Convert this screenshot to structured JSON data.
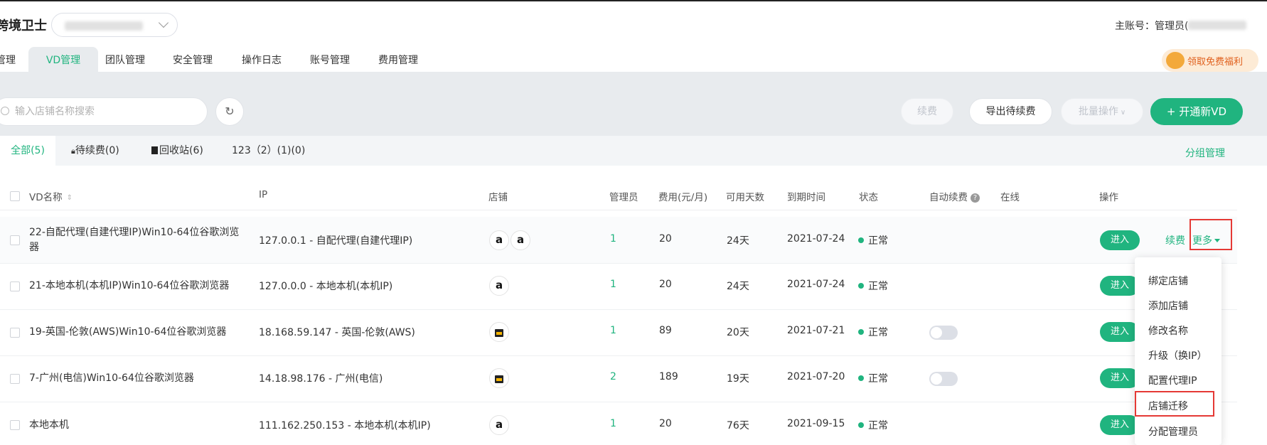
{
  "app": {
    "brand": "跨境卫士",
    "main_account_label": "主账号：管理员("
  },
  "nav": {
    "tabs": [
      {
        "label": "管理",
        "active": false
      },
      {
        "label": "VD管理",
        "active": true
      },
      {
        "label": "团队管理",
        "active": false
      },
      {
        "label": "安全管理",
        "active": false
      },
      {
        "label": "操作日志",
        "active": false
      },
      {
        "label": "账号管理",
        "active": false
      },
      {
        "label": "费用管理",
        "active": false
      }
    ]
  },
  "promo": {
    "label": "领取免费福利"
  },
  "toolbar": {
    "search_placeholder": "输入店铺名称搜索",
    "renew": "续费",
    "export": "导出待续费",
    "batch": "批量操作",
    "new_vd": "+ 开通新VD"
  },
  "subtabs": [
    {
      "label": "全部(5)",
      "active": true
    },
    {
      "label": "待续费(0)",
      "active": false
    },
    {
      "label": "回收站(6)",
      "active": false
    },
    {
      "label": "123（2）(1)(0)",
      "active": false
    }
  ],
  "group_management": "分组管理",
  "table": {
    "headers": {
      "name": "VD名称",
      "ip": "IP",
      "shop": "店铺",
      "admin": "管理员",
      "fee": "费用(元/月)",
      "days": "可用天数",
      "expire": "到期时间",
      "status": "状态",
      "auto_renew": "自动续费",
      "online": "在线",
      "action": "操作"
    },
    "rows": [
      {
        "name": "22-自配代理(自建代理IP)Win10-64位谷歌浏览器",
        "ip": "127.0.0.1 - 自配代理(自建代理IP)",
        "shops": [
          "amazon",
          "amazon"
        ],
        "admin": "1",
        "fee": "20",
        "days": "24天",
        "expire": "2021-07-24",
        "status": "正常",
        "auto_renew_toggle": false,
        "enter": "进入",
        "renew": "续费",
        "more": "更多"
      },
      {
        "name": "21-本地本机(本机IP)Win10-64位谷歌浏览器",
        "ip": "127.0.0.0 - 本地本机(本机IP)",
        "shops": [
          "amazon"
        ],
        "admin": "1",
        "fee": "20",
        "days": "24天",
        "expire": "2021-07-24",
        "status": "正常",
        "auto_renew_toggle": false,
        "enter": "进入"
      },
      {
        "name": "19-英国-伦敦(AWS)Win10-64位谷歌浏览器",
        "ip": "18.168.59.147 - 英国-伦敦(AWS)",
        "shops": [
          "shop-bag"
        ],
        "admin": "1",
        "fee": "89",
        "days": "20天",
        "expire": "2021-07-21",
        "status": "正常",
        "auto_renew_toggle": true,
        "enter": "进入"
      },
      {
        "name": "7-广州(电信)Win10-64位谷歌浏览器",
        "ip": "14.18.98.176 - 广州(电信)",
        "shops": [
          "shop-bag"
        ],
        "admin": "2",
        "fee": "189",
        "days": "19天",
        "expire": "2021-07-20",
        "status": "正常",
        "auto_renew_toggle": true,
        "enter": "进入"
      },
      {
        "name": "本地本机",
        "ip": "111.162.250.153 - 本地本机(本机IP)",
        "shops": [
          "amazon"
        ],
        "admin": "1",
        "fee": "20",
        "days": "76天",
        "expire": "2021-09-15",
        "status": "正常",
        "auto_renew_toggle": false,
        "enter": "进入"
      }
    ]
  },
  "dropdown": {
    "items": [
      "绑定店铺",
      "添加店铺",
      "修改名称",
      "升级（换IP）",
      "配置代理IP",
      "店铺迁移",
      "分配管理员"
    ],
    "highlighted": "店铺迁移"
  },
  "colors": {
    "accent": "#20b47f",
    "highlight": "#e53935"
  }
}
